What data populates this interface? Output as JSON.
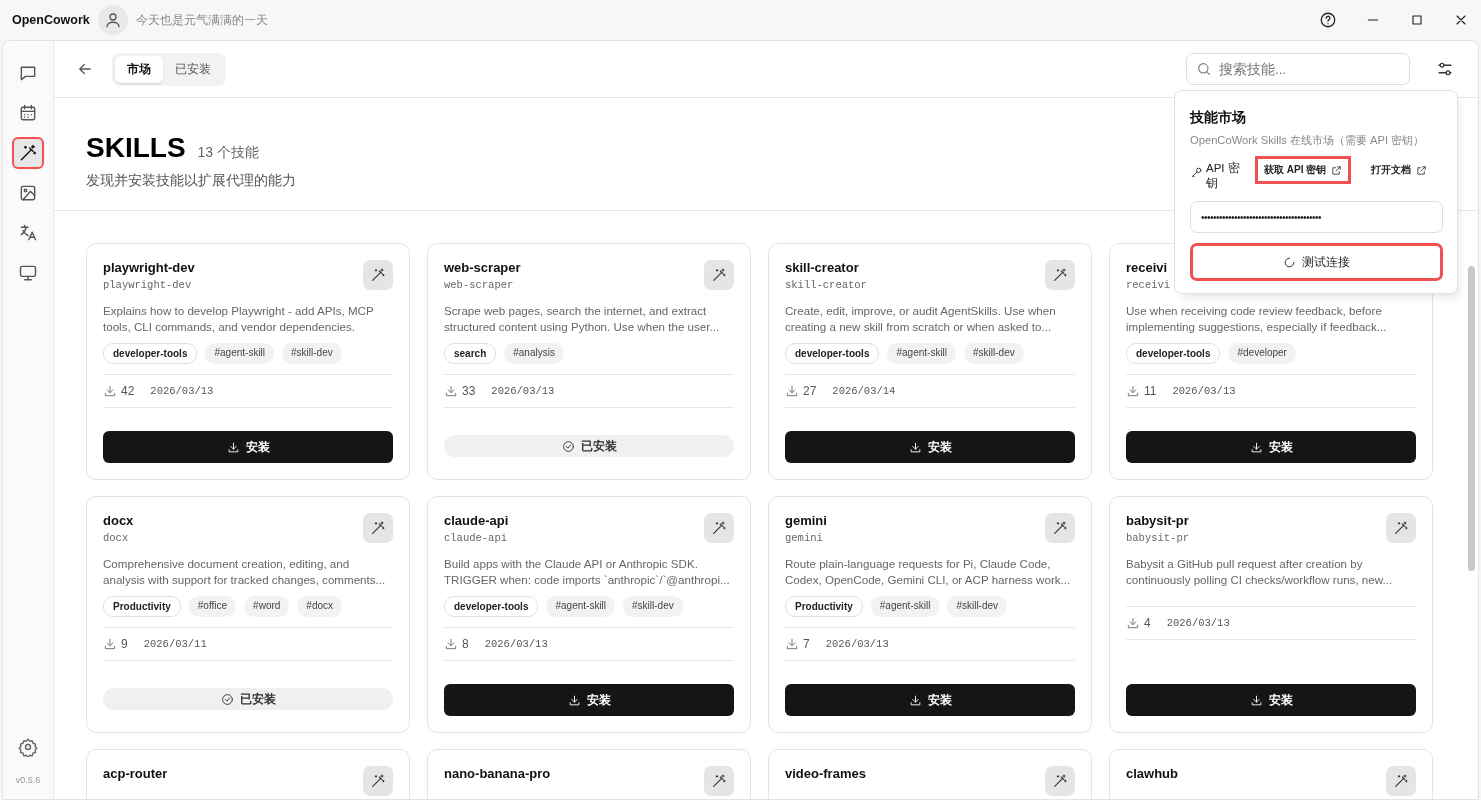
{
  "app": {
    "title": "OpenCowork",
    "greeting": "今天也是元气满满的一天"
  },
  "sidebar": {
    "items": [
      {
        "selected": false,
        "highlighted": false
      },
      {
        "selected": false,
        "highlighted": false
      },
      {
        "selected": true,
        "highlighted": true
      },
      {
        "selected": false,
        "highlighted": false
      },
      {
        "selected": false,
        "highlighted": false
      },
      {
        "selected": false,
        "highlighted": false
      }
    ],
    "version": "v0.5.6"
  },
  "tabs": [
    {
      "label": "市场",
      "selected": true
    },
    {
      "label": "已安装",
      "selected": false
    }
  ],
  "search": {
    "placeholder": "搜索技能..."
  },
  "header": {
    "title": "SKILLS",
    "count": "13 个技能",
    "subtitle": "发现并安装技能以扩展代理的能力"
  },
  "cards": [
    {
      "name": "playwright-dev",
      "slug": "playwright-dev",
      "description": "Explains how to develop Playwright - add APIs, MCP tools, CLI commands, and vendor dependencies.",
      "tags": [
        {
          "label": "developer-tools",
          "kind": "category"
        },
        {
          "label": "#agent-skill",
          "kind": "hashtag"
        },
        {
          "label": "#skill-dev",
          "kind": "hashtag"
        }
      ],
      "downloads": "42",
      "date": "2026/03/13",
      "installed": false,
      "button": "安装"
    },
    {
      "name": "web-scraper",
      "slug": "web-scraper",
      "description": "Scrape web pages, search the internet, and extract structured content using Python. Use when the user...",
      "tags": [
        {
          "label": "search",
          "kind": "category"
        },
        {
          "label": "#analysis",
          "kind": "hashtag"
        }
      ],
      "downloads": "33",
      "date": "2026/03/13",
      "installed": true,
      "button": "已安装"
    },
    {
      "name": "skill-creator",
      "slug": "skill-creator",
      "description": "Create, edit, improve, or audit AgentSkills. Use when creating a new skill from scratch or when asked to...",
      "tags": [
        {
          "label": "developer-tools",
          "kind": "category"
        },
        {
          "label": "#agent-skill",
          "kind": "hashtag"
        },
        {
          "label": "#skill-dev",
          "kind": "hashtag"
        }
      ],
      "downloads": "27",
      "date": "2026/03/14",
      "installed": false,
      "button": "安装"
    },
    {
      "name": "receivi",
      "slug": "receivi",
      "icon_covered": true,
      "description": "Use when receiving code review feedback, before implementing suggestions, especially if feedback...",
      "tags": [
        {
          "label": "developer-tools",
          "kind": "category"
        },
        {
          "label": "#developer",
          "kind": "hashtag"
        }
      ],
      "downloads": "11",
      "date": "2026/03/13",
      "installed": false,
      "button": "安装"
    },
    {
      "name": "docx",
      "slug": "docx",
      "description": "Comprehensive document creation, editing, and analysis with support for tracked changes, comments...",
      "tags": [
        {
          "label": "Productivity",
          "kind": "category"
        },
        {
          "label": "#office",
          "kind": "hashtag"
        },
        {
          "label": "#word",
          "kind": "hashtag"
        },
        {
          "label": "#docx",
          "kind": "hashtag"
        }
      ],
      "downloads": "9",
      "date": "2026/03/11",
      "installed": true,
      "button": "已安装"
    },
    {
      "name": "claude-api",
      "slug": "claude-api",
      "description": "Build apps with the Claude API or Anthropic SDK. TRIGGER when: code imports `anthropic`/`@anthropi...",
      "tags": [
        {
          "label": "developer-tools",
          "kind": "category"
        },
        {
          "label": "#agent-skill",
          "kind": "hashtag"
        },
        {
          "label": "#skill-dev",
          "kind": "hashtag"
        }
      ],
      "downloads": "8",
      "date": "2026/03/13",
      "installed": false,
      "button": "安装"
    },
    {
      "name": "gemini",
      "slug": "gemini",
      "description": "Route plain-language requests for Pi, Claude Code, Codex, OpenCode, Gemini CLI, or ACP harness work...",
      "tags": [
        {
          "label": "Productivity",
          "kind": "category"
        },
        {
          "label": "#agent-skill",
          "kind": "hashtag"
        },
        {
          "label": "#skill-dev",
          "kind": "hashtag"
        }
      ],
      "downloads": "7",
      "date": "2026/03/13",
      "installed": false,
      "button": "安装"
    },
    {
      "name": "babysit-pr",
      "slug": "babysit-pr",
      "description": "Babysit a GitHub pull request after creation by continuously polling CI checks/workflow runs, new...",
      "downloads": "4",
      "date": "2026/03/13",
      "installed": false,
      "button": "安装"
    },
    {
      "name": "acp-router"
    },
    {
      "name": "nano-banana-pro"
    },
    {
      "name": "video-frames"
    },
    {
      "name": "clawhub"
    }
  ],
  "popup": {
    "title": "技能市场",
    "subtitle": "OpenCoWork Skills 在线市场（需要 API 密钥）",
    "key_label": "API 密钥",
    "links": [
      {
        "label": "获取 API 密钥",
        "highlighted": true
      },
      {
        "label": "打开文档",
        "highlighted": false
      }
    ],
    "key_value": "••••••••••••••••••••••••••••••••••••••••",
    "test_button": {
      "label": "测试连接",
      "highlighted": true
    }
  }
}
